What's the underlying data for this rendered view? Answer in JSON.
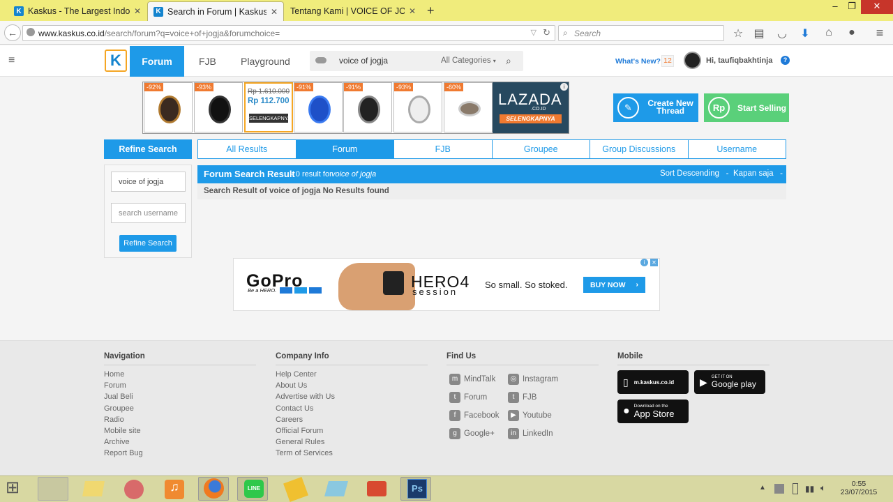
{
  "browser": {
    "tabs": [
      {
        "title": "Kaskus - The Largest Indon..."
      },
      {
        "title": "Search in Forum | Kaskus - ..."
      },
      {
        "title": "Tentang Kami | VOICE OF JOGJA"
      }
    ],
    "url_domain": "www.kaskus.co.id",
    "url_path": "/search/forum?q=voice+of+jogja&forumchoice=",
    "search_placeholder": "Search"
  },
  "header": {
    "logo": "K",
    "tabs": [
      "Forum",
      "FJB",
      "Playground"
    ],
    "search_value": "voice of jogja",
    "category": "All Categories",
    "whats_new": "What's New?",
    "notif_count": "12",
    "greeting": "Hi, taufiqbakhtinja",
    "help": "?"
  },
  "ad": {
    "products": [
      {
        "discount": "-92%"
      },
      {
        "discount": "-93%"
      },
      {
        "old_price": "Rp 1.610.000",
        "new_price": "Rp 112.700",
        "cta": "SELENGKAPNYA"
      },
      {
        "discount": "-91%"
      },
      {
        "discount": "-91%"
      },
      {
        "discount": "-93%"
      },
      {
        "discount": "-60%"
      }
    ],
    "brand": "LAZADA",
    "brand_sub": ".CO.ID",
    "brand_cta": "SELENGKAPNYA",
    "create_thread": "Create New Thread",
    "start_selling": "Start Selling",
    "sell_icon": "Rp"
  },
  "search": {
    "refine_title": "Refine Search",
    "tabs": [
      "All Results",
      "Forum",
      "FJB",
      "Groupee",
      "Group Discussions",
      "Username"
    ],
    "keyword_value": "voice of jogja",
    "username_placeholder": "search username",
    "refine_button": "Refine Search",
    "result_title": "Forum Search Result",
    "result_count": " - 0 result for ",
    "result_query": "voice of jogja",
    "sort": "Sort Descending",
    "time": "Kapan saja",
    "no_result": "Search Result of voice of jogja No Results found"
  },
  "gopro": {
    "brand": "GoPro",
    "tagline": "Be a HERO.",
    "model": "HERO4",
    "model_sub": "session",
    "slogan": "So small. So stoked.",
    "cta": "BUY NOW"
  },
  "footer": {
    "navigation": {
      "title": "Navigation",
      "links": [
        "Home",
        "Forum",
        "Jual Beli",
        "Groupee",
        "Radio",
        "Mobile site",
        "Archive",
        "Report Bug"
      ]
    },
    "company": {
      "title": "Company Info",
      "links": [
        "Help Center",
        "About Us",
        "Advertise with Us",
        "Contact Us",
        "Careers",
        "Official Forum",
        "General Rules",
        "Term of Services"
      ]
    },
    "findus": {
      "title": "Find Us",
      "left": [
        "MindTalk",
        "Forum",
        "Facebook",
        "Google+"
      ],
      "right": [
        "Instagram",
        "FJB",
        "Youtube",
        "LinkedIn"
      ]
    },
    "mobile": {
      "title": "Mobile",
      "site": "m.kaskus.co.id",
      "gplay_small": "GET IT ON",
      "gplay": "Google play",
      "appstore_small": "Download on the",
      "appstore": "App Store"
    }
  },
  "taskbar": {
    "time": "0:55",
    "date": "23/07/2015"
  }
}
